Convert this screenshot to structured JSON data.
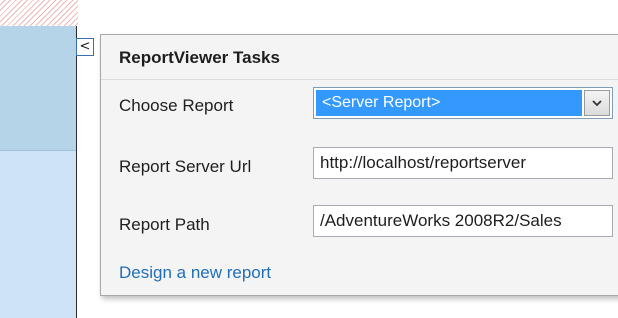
{
  "panel": {
    "title": "ReportViewer Tasks",
    "collapse_glyph": "<",
    "choose_report": {
      "label": "Choose Report",
      "selected": "<Server Report>"
    },
    "report_server_url": {
      "label": "Report Server Url",
      "value": "http://localhost/reportserver"
    },
    "report_path": {
      "label": "Report Path",
      "value": "/AdventureWorks 2008R2/Sales"
    },
    "design_link": "Design a new report"
  },
  "colors": {
    "selection": "#3399ff",
    "link": "#1f6fb8",
    "designer_surface": "#cfe3f6"
  },
  "icons": {
    "collapse": "chevron-left-icon",
    "dropdown": "chevron-down-icon"
  }
}
